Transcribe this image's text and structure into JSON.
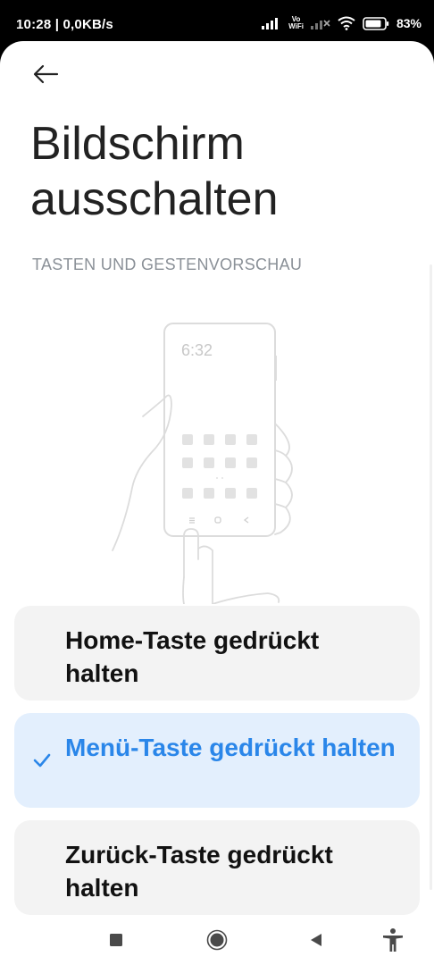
{
  "status_bar": {
    "time_speed": "10:28 | 0,0KB/s",
    "vowifi_top": "Vo",
    "vowifi_bottom": "WiFi",
    "battery_pct": "83%"
  },
  "header": {
    "back_icon": "arrow-left-icon",
    "title": "Bildschirm ausschalten"
  },
  "section": {
    "label": "TASTEN UND GESTENVORSCHAU"
  },
  "illustration": {
    "phone_clock": "6:32"
  },
  "options": [
    {
      "label": "Home-Taste gedrückt halten",
      "selected": false
    },
    {
      "label": "Menü-Taste gedrückt halten",
      "selected": true
    },
    {
      "label": "Zurück-Taste gedrückt halten",
      "selected": false
    }
  ],
  "colors": {
    "accent": "#2a86e9",
    "selected_bg": "#e3effd",
    "card_bg": "#f3f3f3"
  },
  "navbar": {
    "icons": [
      "square-recents-icon",
      "circle-home-icon",
      "triangle-back-icon",
      "accessibility-icon"
    ]
  }
}
